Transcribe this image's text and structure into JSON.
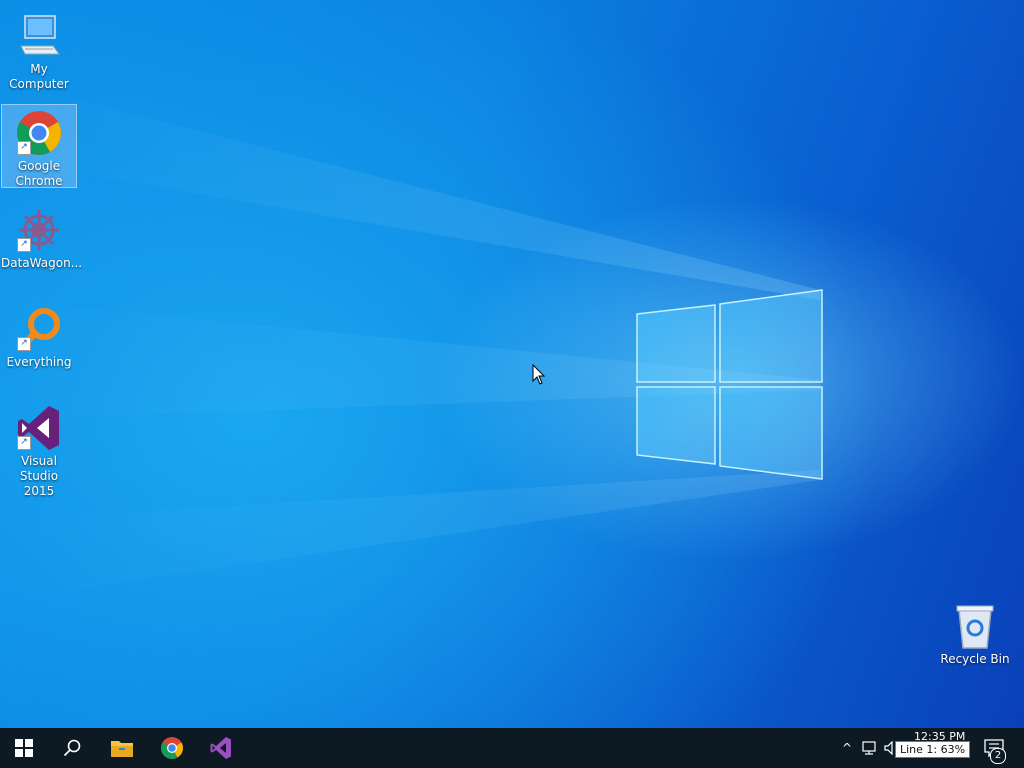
{
  "desktop": {
    "icons": [
      {
        "label": "My Computer",
        "icon": "computer-icon"
      },
      {
        "label": "Google\nChrome",
        "icon": "chrome-icon"
      },
      {
        "label": "DataWagon...",
        "icon": "datawagon-icon"
      },
      {
        "label": "Everything",
        "icon": "everything-search-icon"
      },
      {
        "label": "Visual Studio\n2015",
        "icon": "visual-studio-icon"
      },
      {
        "label": "Recycle Bin",
        "icon": "recycle-bin-icon"
      }
    ]
  },
  "taskbar": {
    "pinned": [
      {
        "icon": "start-icon"
      },
      {
        "icon": "search-icon"
      },
      {
        "icon": "file-explorer-icon"
      },
      {
        "icon": "chrome-icon"
      },
      {
        "icon": "visual-studio-icon"
      }
    ],
    "tray": {
      "clock": "12:35 PM",
      "tooltip": "Line 1: 63%",
      "notification_count": "2"
    }
  },
  "colors": {
    "taskbar": "#0d1a24",
    "wallpaper": "#0a7fe0"
  }
}
